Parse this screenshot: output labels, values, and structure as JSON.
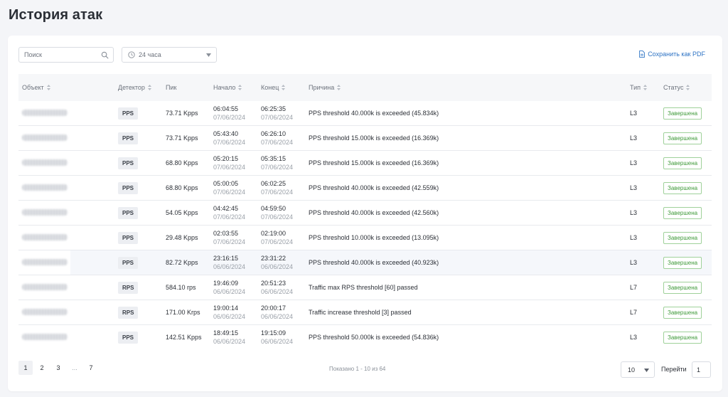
{
  "page": {
    "title": "История атак"
  },
  "toolbar": {
    "search_placeholder": "Поиск",
    "period_value": "24 часа",
    "export_label": "Сохранить как PDF"
  },
  "table": {
    "columns": {
      "object": "Объект",
      "detector": "Детектор",
      "peak": "Пик",
      "start": "Начало",
      "end": "Конец",
      "reason": "Причина",
      "type": "Тип",
      "status": "Статус"
    },
    "rows": [
      {
        "detector": "PPS",
        "peak": "73.71 Kpps",
        "start_time": "06:04:55",
        "start_date": "07/06/2024",
        "end_time": "06:25:35",
        "end_date": "07/06/2024",
        "reason": "PPS threshold 40.000k is exceeded (45.834k)",
        "type": "L3",
        "status": "Завершена"
      },
      {
        "detector": "PPS",
        "peak": "73.71 Kpps",
        "start_time": "05:43:40",
        "start_date": "07/06/2024",
        "end_time": "06:26:10",
        "end_date": "07/06/2024",
        "reason": "PPS threshold 15.000k is exceeded (16.369k)",
        "type": "L3",
        "status": "Завершена"
      },
      {
        "detector": "PPS",
        "peak": "68.80 Kpps",
        "start_time": "05:20:15",
        "start_date": "07/06/2024",
        "end_time": "05:35:15",
        "end_date": "07/06/2024",
        "reason": "PPS threshold 15.000k is exceeded (16.369k)",
        "type": "L3",
        "status": "Завершена"
      },
      {
        "detector": "PPS",
        "peak": "68.80 Kpps",
        "start_time": "05:00:05",
        "start_date": "07/06/2024",
        "end_time": "06:02:25",
        "end_date": "07/06/2024",
        "reason": "PPS threshold 40.000k is exceeded (42.559k)",
        "type": "L3",
        "status": "Завершена"
      },
      {
        "detector": "PPS",
        "peak": "54.05 Kpps",
        "start_time": "04:42:45",
        "start_date": "07/06/2024",
        "end_time": "04:59:50",
        "end_date": "07/06/2024",
        "reason": "PPS threshold 40.000k is exceeded (42.560k)",
        "type": "L3",
        "status": "Завершена"
      },
      {
        "detector": "PPS",
        "peak": "29.48 Kpps",
        "start_time": "02:03:55",
        "start_date": "07/06/2024",
        "end_time": "02:19:00",
        "end_date": "07/06/2024",
        "reason": "PPS threshold 10.000k is exceeded (13.095k)",
        "type": "L3",
        "status": "Завершена"
      },
      {
        "detector": "PPS",
        "peak": "82.72 Kpps",
        "start_time": "23:16:15",
        "start_date": "06/06/2024",
        "end_time": "23:31:22",
        "end_date": "06/06/2024",
        "reason": "PPS threshold 40.000k is exceeded (40.923k)",
        "type": "L3",
        "status": "Завершена"
      },
      {
        "detector": "RPS",
        "peak": "584.10 rps",
        "start_time": "19:46:09",
        "start_date": "06/06/2024",
        "end_time": "20:51:23",
        "end_date": "06/06/2024",
        "reason": "Traffic max RPS threshold [60] passed",
        "type": "L7",
        "status": "Завершена"
      },
      {
        "detector": "RPS",
        "peak": "171.00 Krps",
        "start_time": "19:00:14",
        "start_date": "06/06/2024",
        "end_time": "20:00:17",
        "end_date": "06/06/2024",
        "reason": "Traffic increase threshold [3] passed",
        "type": "L7",
        "status": "Завершена"
      },
      {
        "detector": "PPS",
        "peak": "142.51 Kpps",
        "start_time": "18:49:15",
        "start_date": "06/06/2024",
        "end_time": "19:15:09",
        "end_date": "06/06/2024",
        "reason": "PPS threshold 50.000k is exceeded (54.836k)",
        "type": "L3",
        "status": "Завершена"
      }
    ]
  },
  "pagination": {
    "pages": [
      "1",
      "2",
      "3",
      "...",
      "7"
    ],
    "current": "1",
    "shown_text": "Показано 1 - 10 из 64",
    "page_size": "10",
    "goto_label": "Перейти",
    "goto_value": "1"
  },
  "colors": {
    "accent": "#2d73c4",
    "status_green": "#3f9a3a",
    "status_border": "#9fd19a"
  }
}
